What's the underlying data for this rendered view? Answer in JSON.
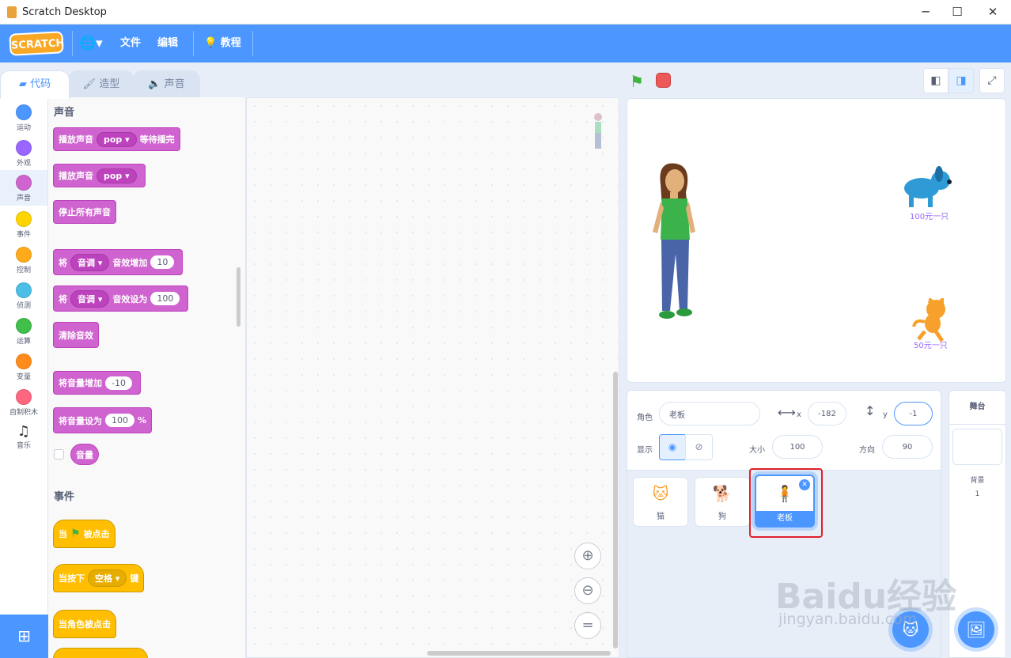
{
  "window": {
    "title": "Scratch Desktop",
    "minimize": "─",
    "maximize": "☐",
    "close": "✕"
  },
  "menubar": {
    "logo": "SCRATCH",
    "language": "🌐▾",
    "file": "文件",
    "edit": "编辑",
    "tutorials": "教程"
  },
  "tabs": {
    "code": "代码",
    "costumes": "造型",
    "sounds": "声音"
  },
  "categories": [
    {
      "label": "运动",
      "color": "#4c97ff"
    },
    {
      "label": "外观",
      "color": "#9966ff"
    },
    {
      "label": "声音",
      "color": "#cf63cf"
    },
    {
      "label": "事件",
      "color": "#ffd500"
    },
    {
      "label": "控制",
      "color": "#ffab19"
    },
    {
      "label": "侦测",
      "color": "#4cbfe6"
    },
    {
      "label": "运算",
      "color": "#40bf4a"
    },
    {
      "label": "变量",
      "color": "#ff8c1a"
    },
    {
      "label": "自制积木",
      "color": "#ff6680"
    },
    {
      "label": "音乐",
      "color": ""
    }
  ],
  "palette": {
    "sound_heading": "声音",
    "play_until_done": {
      "pre": "播放声音",
      "sound": "pop ▾",
      "post": "等待播完"
    },
    "start_sound": {
      "pre": "播放声音",
      "sound": "pop ▾"
    },
    "stop_all": "停止所有声音",
    "change_effect": {
      "pre": "将",
      "effect": "音调 ▾",
      "mid": "音效增加",
      "value": "10"
    },
    "set_effect": {
      "pre": "将",
      "effect": "音调 ▾",
      "mid": "音效设为",
      "value": "100"
    },
    "clear_effects": "清除音效",
    "change_volume": {
      "label": "将音量增加",
      "value": "-10"
    },
    "set_volume": {
      "label": "将音量设为",
      "value": "100",
      "unit": "%"
    },
    "volume_reporter": "音量",
    "events_heading": "事件",
    "when_flag": {
      "pre": "当",
      "post": "被点击"
    },
    "when_key": {
      "pre": "当按下",
      "key": "空格 ▾",
      "post": "键"
    },
    "when_clicked": "当角色被点击"
  },
  "stage": {
    "dog_label": "100元一只",
    "cat_label": "50元一只"
  },
  "sprite_info": {
    "sprite_label": "角色",
    "sprite_name": "老板",
    "x_label": "x",
    "x_value": "-182",
    "y_label": "y",
    "y_value": "-1",
    "show_label": "显示",
    "size_label": "大小",
    "size_value": "100",
    "direction_label": "方向",
    "direction_value": "90"
  },
  "sprites": [
    {
      "name": "猫",
      "selected": false
    },
    {
      "name": "狗",
      "selected": false
    },
    {
      "name": "老板",
      "selected": true
    }
  ],
  "stage_pane": {
    "title": "舞台",
    "backdrops_label": "背景",
    "backdrops_count": "1"
  },
  "watermark": {
    "brand": "Baidu经验",
    "url": "jingyan.baidu.com"
  },
  "colors": {
    "accent": "#4c97ff",
    "sound": "#cf63cf",
    "events": "#ffbf00",
    "highlight": "#e0202a"
  }
}
